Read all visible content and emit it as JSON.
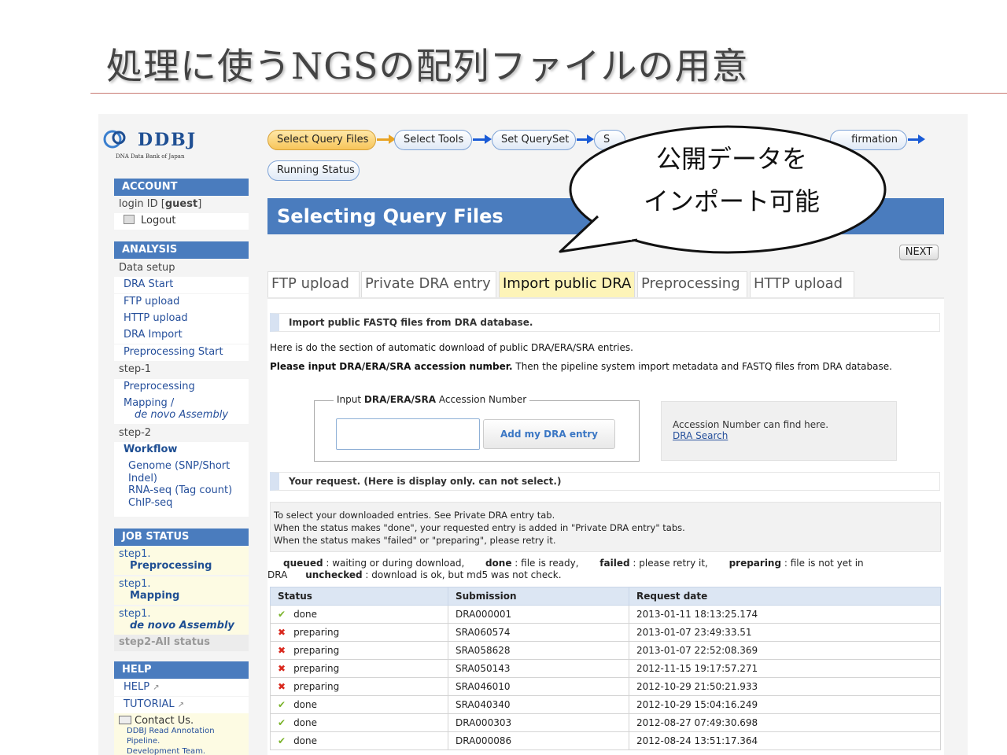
{
  "slide": {
    "title": "処理に使うNGSの配列ファイルの用意"
  },
  "sidebar": {
    "logo_name": "DDBJ",
    "logo_sub": "DNA Data Bank of Japan",
    "account_header": "ACCOUNT",
    "login_text": "login ID [guest]",
    "logout": "Logout",
    "analysis_header": "ANALYSIS",
    "data_setup": "Data setup",
    "dra_start": "DRA Start",
    "ftp_upload": "FTP upload",
    "http_upload": "HTTP upload",
    "dra_import": "DRA Import",
    "preprocessing_start": "Preprocessing Start",
    "step1": "step-1",
    "preprocessing": "Preprocessing",
    "mapping": "Mapping /",
    "de_novo": "de novo Assembly",
    "step2": "step-2",
    "workflow": "Workflow",
    "genome": "Genome (SNP/Short",
    "indel": "Indel)",
    "rnaseq": "RNA-seq (Tag count)",
    "chipseq": "ChIP-seq",
    "job_header": "JOB STATUS",
    "js1_step": "step1.",
    "js1_name": "Preprocessing",
    "js2_step": "step1.",
    "js2_name": "Mapping",
    "js3_step": "step1.",
    "js3_name": "de novo Assembly",
    "js_all": "step2-All status",
    "help_header": "HELP",
    "help": "HELP",
    "tutorial": "TUTORIAL",
    "contact": "Contact Us.",
    "contact_l1": "DDBJ Read Annotation",
    "contact_l2": "Pipeline.",
    "contact_l3": "Development Team."
  },
  "steps": {
    "s1": "Select Query Files",
    "s2": "Select Tools",
    "s3": "Set QuerySet",
    "s4": "S",
    "s5": "firmation",
    "running": "Running Status"
  },
  "banner": "Selecting Query Files",
  "next": "NEXT",
  "tabs": [
    "FTP upload",
    "Private DRA entry",
    "Import public DRA",
    "Preprocessing",
    "HTTP upload"
  ],
  "import": {
    "header": "Import public FASTQ files from DRA database.",
    "line1": "Here is do the section of automatic download of public DRA/ERA/SRA entries.",
    "line2_bold": "Please input DRA/ERA/SRA accession number.",
    "line2_rest": " Then the pipeline system import metadata and FASTQ files from DRA database.",
    "legend_pre": "Input ",
    "legend_bold": "DRA/ERA/SRA",
    "legend_post": " Accession Number",
    "input_value": "",
    "add_button": "Add my DRA entry",
    "hint_text": "Accession Number can find here.",
    "hint_link": "DRA Search"
  },
  "request": {
    "header": "Your request. (Here is display only. can not select.)",
    "info1": "To select your downloaded entries. See Private DRA entry tab.",
    "info2": "When the status makes \"done\", your requested entry is added in \"Private DRA entry\" tabs.",
    "info3": "When the status makes \"failed\" or \"preparing\", please retry it.",
    "lg_queued": "queued",
    "lg_queued_d": " : waiting or during download,",
    "lg_done": "done",
    "lg_done_d": " : file is ready,",
    "lg_failed": "failed",
    "lg_failed_d": " : please retry it,",
    "lg_preparing": "preparing",
    "lg_preparing_d": " : file is not yet in",
    "lg_dra": "DRA",
    "lg_unchecked": "unchecked",
    "lg_unchecked_d": " : download is ok, but md5 was not check."
  },
  "table": {
    "headers": [
      "Status",
      "Submission",
      "Request date"
    ],
    "rows": [
      {
        "ok": true,
        "status": "done",
        "submission": "DRA000001",
        "date": "2013-01-11 18:13:25.174"
      },
      {
        "ok": false,
        "status": "preparing",
        "submission": "SRA060574",
        "date": "2013-01-07 23:49:33.51"
      },
      {
        "ok": false,
        "status": "preparing",
        "submission": "SRA058628",
        "date": "2013-01-07 22:52:08.369"
      },
      {
        "ok": false,
        "status": "preparing",
        "submission": "SRA050143",
        "date": "2012-11-15 19:17:57.271"
      },
      {
        "ok": false,
        "status": "preparing",
        "submission": "SRA046010",
        "date": "2012-10-29 21:50:21.933"
      },
      {
        "ok": true,
        "status": "done",
        "submission": "SRA040340",
        "date": "2012-10-29 15:04:16.249"
      },
      {
        "ok": true,
        "status": "done",
        "submission": "DRA000303",
        "date": "2012-08-27 07:49:30.698"
      },
      {
        "ok": true,
        "status": "done",
        "submission": "DRA000086",
        "date": "2012-08-24 13:51:17.364"
      }
    ]
  },
  "callout": {
    "line1": "公開データを",
    "line2": "インポート可能"
  }
}
